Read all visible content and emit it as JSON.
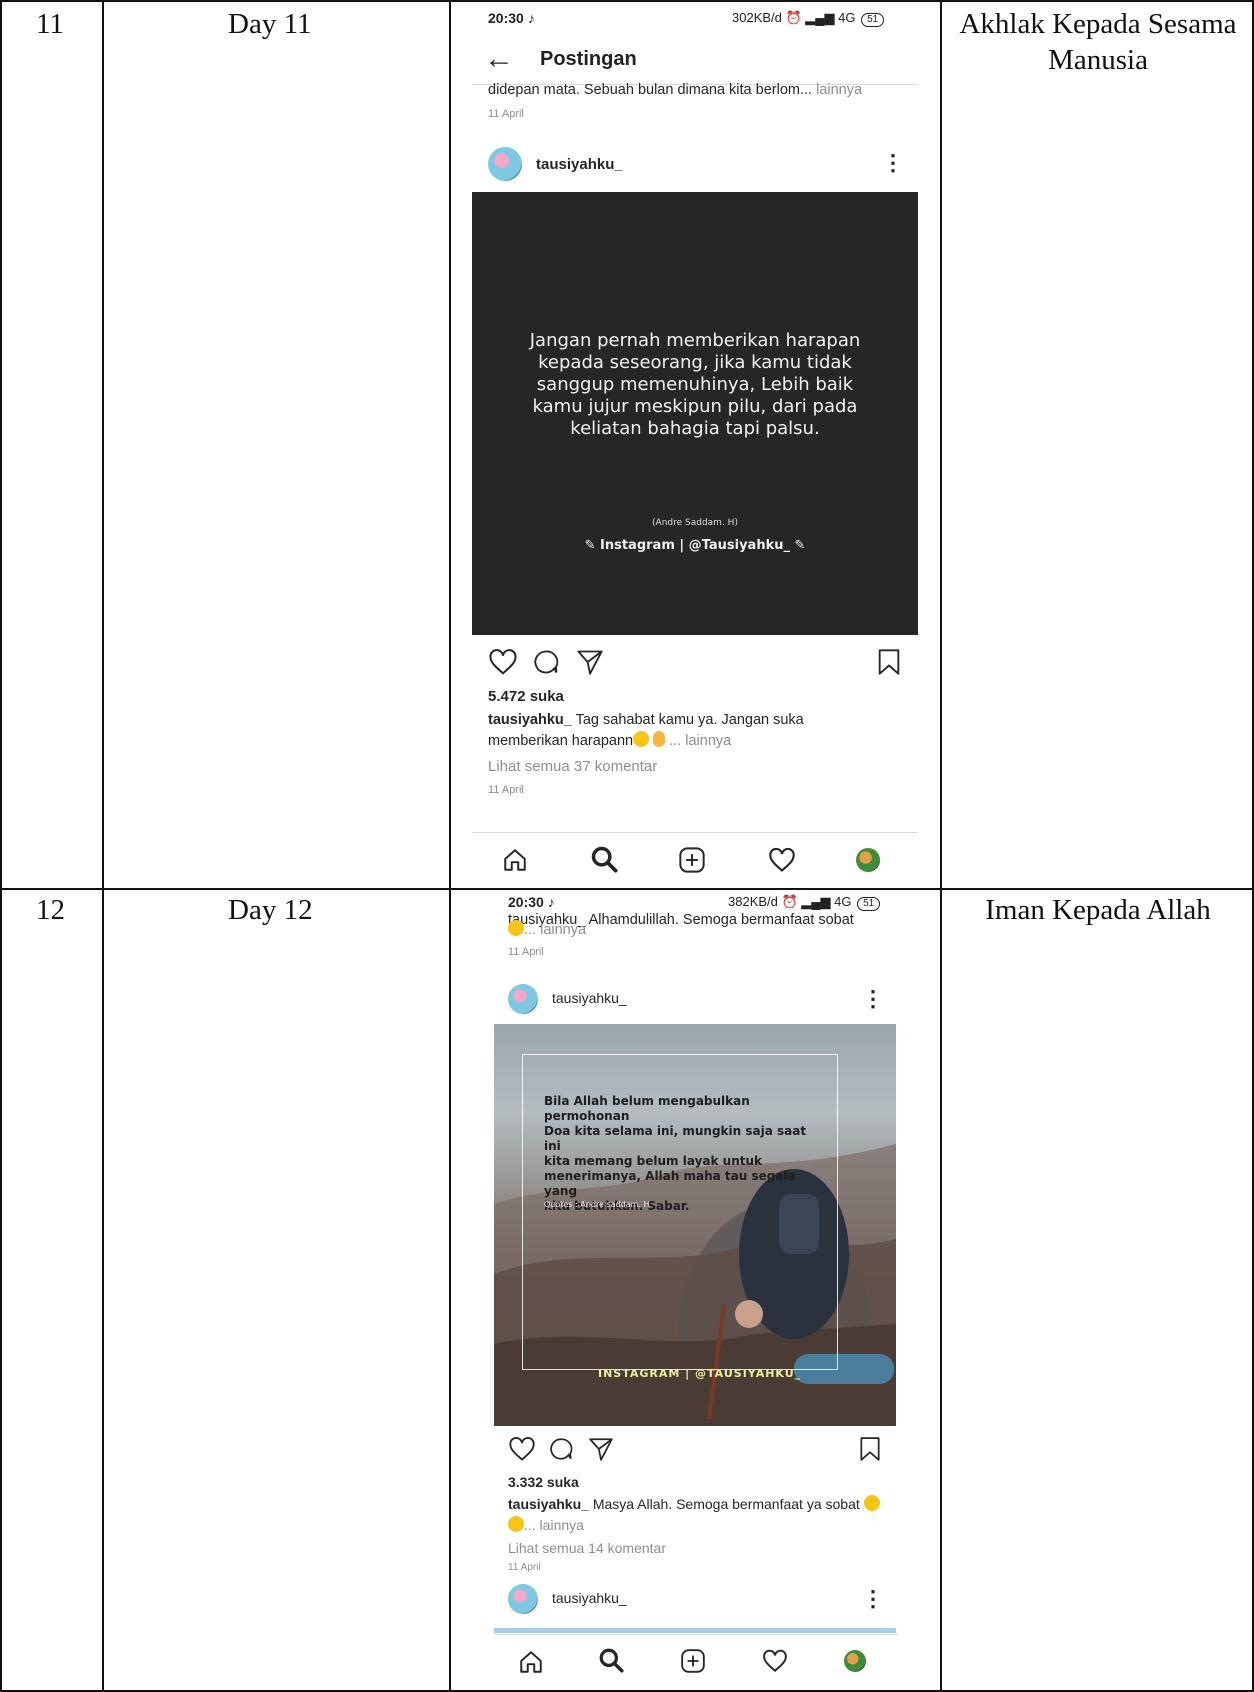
{
  "rows": [
    {
      "number": "11",
      "day": "Day 11",
      "topic": "Akhlak Kepada Sesama Manusia",
      "screenshot": {
        "status_time": "20:30",
        "status_right": "302KB/d",
        "battery": "51",
        "screen_title": "Postingan",
        "prev_caption_tail": "didepan mata. Sebuah bulan dimana kita berlom...",
        "prev_more": "lainnya",
        "prev_date": "11 April",
        "username": "tausiyahku_",
        "quote_lines": [
          "Jangan pernah memberikan harapan",
          "kepada seseorang, jika kamu tidak",
          "sanggup memenuhinya, Lebih baik",
          "kamu jujur meskipun pilu, dari pada",
          "keliatan bahagia tapi palsu."
        ],
        "quote_author": "(Andre Saddam. H)",
        "quote_ig": "✎ Instagram | @Tausiyahku_ ✎",
        "likes": "5.472 suka",
        "caption_user": "tausiyahku_",
        "caption_text_1": "Tag sahabat kamu ya. Jangan suka",
        "caption_text_2": "memberikan harapann",
        "caption_more": "... lainnya",
        "comments_link": "Lihat semua 37 komentar",
        "date": "11 April"
      }
    },
    {
      "number": "12",
      "day": "Day 12",
      "topic": "Iman Kepada Allah",
      "screenshot": {
        "status_time": "20:30",
        "status_right": "382KB/d",
        "battery": "51",
        "prev_caption_tail": "tausiyahku_ Alhamdulillah. Semoga bermanfaat sobat",
        "prev_more": "... lainnya",
        "prev_date": "11 April",
        "username": "tausiyahku_",
        "quote_lines": [
          "Bila Allah belum mengabulkan permohonan",
          "Doa kita selama ini, mungkin saja saat ini",
          "kita memang belum layak untuk",
          "menerimanya, Allah maha tau segala yang",
          "kita butuhkan. Sabar."
        ],
        "quote_author": "Quotes : Andre saddam. H",
        "quote_ig": "INSTAGRAM | @TAUSIYAHKU_",
        "likes": "3.332 suka",
        "caption_user": "tausiyahku_",
        "caption_text_1": "Masya Allah. Semoga bermanfaat ya sobat",
        "caption_more": "... lainnya",
        "comments_link": "Lihat semua 14 komentar",
        "date": "11 April",
        "next_username": "tausiyahku_"
      }
    }
  ],
  "icons": [
    "heart-icon",
    "comment-icon",
    "share-icon",
    "bookmark-icon",
    "home-icon",
    "search-icon",
    "add-post-icon",
    "activity-heart-icon",
    "profile-avatar-icon",
    "back-arrow-icon",
    "more-options-icon"
  ]
}
